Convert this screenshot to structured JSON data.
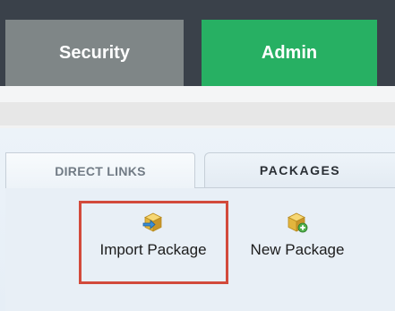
{
  "top_nav": {
    "tabs": [
      {
        "label": "Security",
        "color": "#7f8687"
      },
      {
        "label": "Admin",
        "color": "#27b063"
      }
    ]
  },
  "section_tabs": [
    {
      "label": "DIRECT LINKS",
      "selected": true
    },
    {
      "label": "PACKAGES",
      "selected": false
    }
  ],
  "actions": [
    {
      "label": "Import Package",
      "icon": "import-package-icon",
      "highlighted": true
    },
    {
      "label": "New Package",
      "icon": "new-package-icon",
      "highlighted": false
    }
  ],
  "colors": {
    "header_bg": "#3a414a",
    "highlight_border": "#d24a3b"
  }
}
